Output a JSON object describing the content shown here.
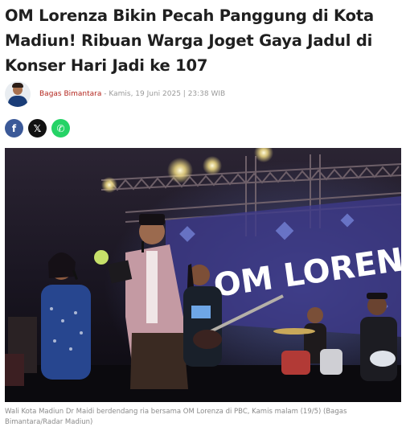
{
  "article": {
    "title": "OM Lorenza Bikin Pecah Panggung di Kota Madiun! Ribuan Warga Joget Gaya Jadul di Konser Hari Jadi ke 107",
    "author": "Bagas Bimantara",
    "date": " - Kamis, 19 Juni 2025 | 23:38 WIB"
  },
  "share": [
    {
      "name": "facebook",
      "glyph": "f",
      "color": "#3b5998"
    },
    {
      "name": "x",
      "glyph": "𝕏",
      "color": "#111111"
    },
    {
      "name": "whatsapp",
      "glyph": "✆",
      "color": "#25d366"
    }
  ],
  "photo": {
    "stage_sign": "OM LORENZ"
  },
  "caption": "Wali Kota Madiun Dr Maidi berdendang ria bersama OM Lorenza di PBC, Kamis malam (19/5) (Bagas Bimantara/Radar Madiun)"
}
